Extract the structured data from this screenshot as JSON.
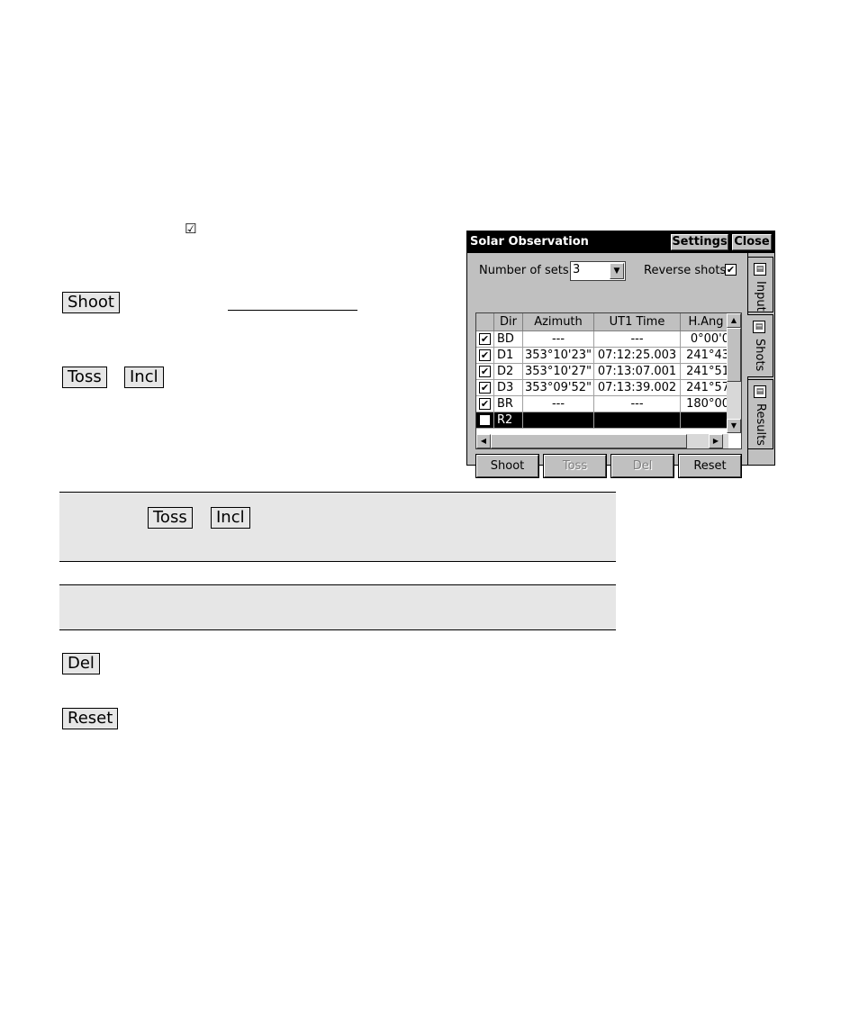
{
  "doc": {
    "checkbox_symbol": "☑",
    "shoot_label": "Shoot",
    "toss_label": "Toss",
    "incl_label": "Incl",
    "band_toss_label": "Toss",
    "band_incl_label": "Incl",
    "del_label": "Del",
    "reset_label": "Reset"
  },
  "device": {
    "title": "Solar Observation",
    "settings_label": "Settings",
    "close_label": "Close",
    "sets_label": "Number of sets",
    "sets_value": "3",
    "reverse_label": "Reverse shots",
    "reverse_checked": "✔",
    "columns": [
      "",
      "Dir",
      "Azimuth",
      "UT1 Time",
      "H.Ang"
    ],
    "rows": [
      {
        "check": "✔",
        "dir": "BD",
        "azimuth": "---",
        "time": "---",
        "hang": "0°00'0"
      },
      {
        "check": "✔",
        "dir": "D1",
        "azimuth": "353°10'23\"",
        "time": "07:12:25.003",
        "hang": "241°43"
      },
      {
        "check": "✔",
        "dir": "D2",
        "azimuth": "353°10'27\"",
        "time": "07:13:07.001",
        "hang": "241°51"
      },
      {
        "check": "✔",
        "dir": "D3",
        "azimuth": "353°09'52\"",
        "time": "07:13:39.002",
        "hang": "241°57"
      },
      {
        "check": "✔",
        "dir": "BR",
        "azimuth": "---",
        "time": "---",
        "hang": "180°00"
      },
      {
        "check": "✔",
        "dir": "R2",
        "azimuth": "",
        "time": "",
        "hang": ""
      }
    ],
    "buttons": {
      "shoot": "Shoot",
      "toss": "Toss",
      "del": "Del",
      "reset": "Reset"
    },
    "tabs": [
      "Input",
      "Shots",
      "Results"
    ]
  }
}
